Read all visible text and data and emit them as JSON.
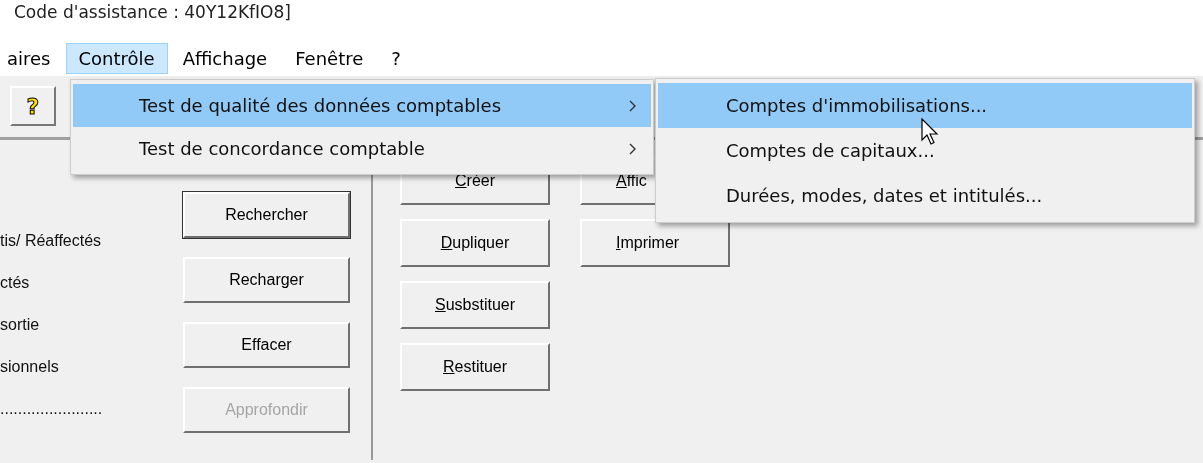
{
  "window": {
    "title": "Code d'assistance : 40Y12KfIO8]"
  },
  "menu_bar": [
    {
      "label": "aires",
      "selected": false
    },
    {
      "label": "Contrôle",
      "selected": true
    },
    {
      "label": "Affichage",
      "selected": false
    },
    {
      "label": "Fenêtre",
      "selected": false
    },
    {
      "label": "?",
      "selected": false
    }
  ],
  "toolbar": {
    "help_button": "?"
  },
  "left_panel": {
    "labels": [
      "tis/ Réaffectés",
      "ctés",
      " sortie",
      "sionnels",
      "......................."
    ],
    "buttons": [
      {
        "label": "Rechercher",
        "disabled": false,
        "default": true
      },
      {
        "label": "Recharger",
        "disabled": false,
        "default": false
      },
      {
        "label": "Effacer",
        "disabled": false,
        "default": false
      },
      {
        "label": "Approfondir",
        "disabled": true,
        "default": false
      }
    ]
  },
  "action_buttons": [
    [
      {
        "label": "Créer",
        "mnemonic": true
      },
      {
        "label": "Dupliquer",
        "mnemonic": true
      },
      {
        "label": "Susbstituer",
        "mnemonic": true
      },
      {
        "label": "Restituer",
        "mnemonic": true
      }
    ],
    [
      {
        "label": "Affic",
        "mnemonic": true
      },
      {
        "label": "Imprimer",
        "mnemonic": true
      }
    ]
  ],
  "dropdown_menu": [
    {
      "label": "Test de qualité des données comptables",
      "selected": true,
      "submenu": true
    },
    {
      "label": "Test de concordance comptable",
      "selected": false,
      "submenu": true
    }
  ],
  "submenu": [
    {
      "label": "Comptes d'immobilisations...",
      "selected": true
    },
    {
      "label": "Comptes de capitaux...",
      "selected": false
    },
    {
      "label": "Durées, modes, dates et intitulés...",
      "selected": false
    }
  ]
}
